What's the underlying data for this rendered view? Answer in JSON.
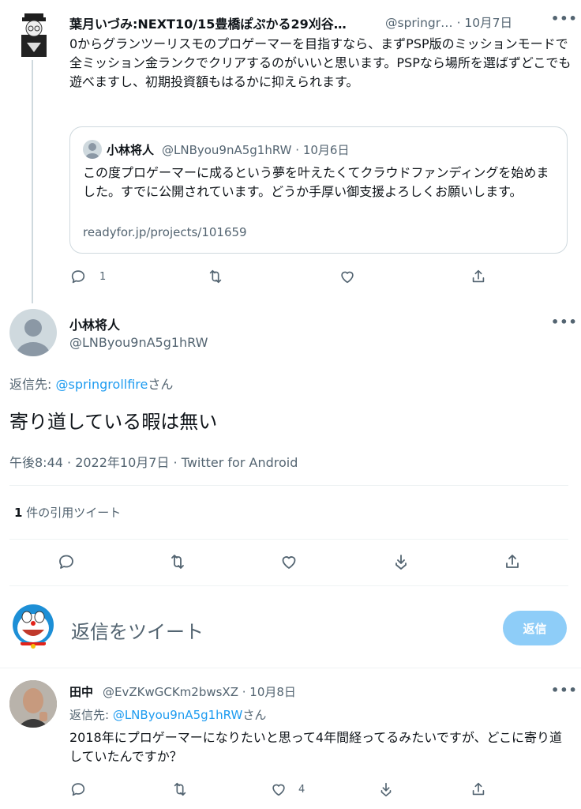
{
  "quoted_parent": {
    "author_name": "葉月いづみ:NEXT10/15豊橋ぽぷかる29刈谷…",
    "handle": "@springr…",
    "date": "· 10月7日",
    "text": "0からグランツーリスモのプロゲーマーを目指すなら、まずPSP版のミッションモードで全ミッション金ランクでクリアするのがいいと思います。PSPなら場所を選ばずどこでも遊べますし、初期投資額もはるかに抑えられます。",
    "quote": {
      "author_name": "小林将人",
      "handle": "@LNByou9nA5g1hRW",
      "date": "· 10月6日",
      "text": "この度プロゲーマーに成るという夢を叶えたくてクラウドファンディングを始めました。すでに公開されています。どうか手厚い御支援よろしくお願いします。",
      "link": "readyfor.jp/projects/101659"
    },
    "actions": {
      "reply_count": "1"
    }
  },
  "main_tweet": {
    "author_name": "小林将人",
    "handle": "@LNByou9nA5g1hRW",
    "reply_to_prefix": "返信先: ",
    "reply_to_handle": "@springrollfire",
    "reply_to_suffix": "さん",
    "text": "寄り道している暇は無い",
    "meta": "午後8:44 · 2022年10月7日 · Twitter for Android",
    "quote_count": "1",
    "quote_label": " 件の引用ツイート"
  },
  "composer": {
    "placeholder": "返信をツイート",
    "button_label": "返信"
  },
  "reply": {
    "author_name": "田中",
    "handle": "@EvZKwGCKm2bwsXZ · 10月8日",
    "reply_to_prefix": "返信先: ",
    "reply_to_handle": "@LNByou9nA5g1hRW",
    "reply_to_suffix": "さん",
    "text": "2018年にプロゲーマーになりたいと思って4年間経ってるみたいですが、どこに寄り道していたんですか？",
    "like_count": "4"
  },
  "icons": {
    "more": "more-horizontal-icon",
    "reply": "reply-icon",
    "retweet": "retweet-icon",
    "like": "like-icon",
    "bookmark": "bookmark-icon",
    "share": "share-icon"
  },
  "colors": {
    "accent": "#1d9bf0",
    "button_disabled": "#8ecdf8",
    "muted": "#536471",
    "border": "#cfd9de"
  }
}
